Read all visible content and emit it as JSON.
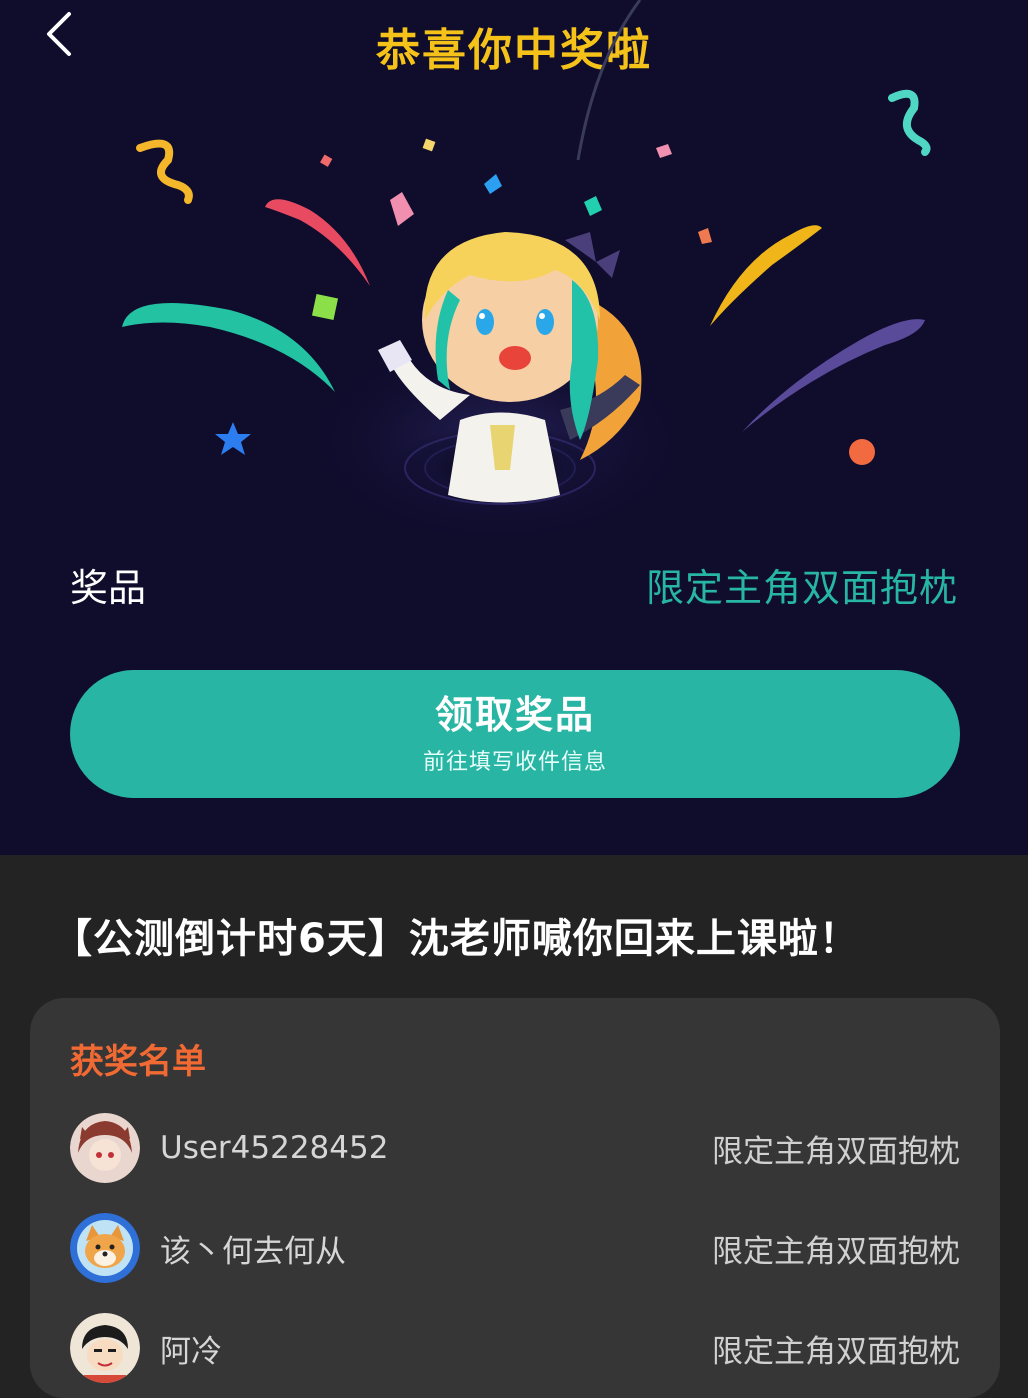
{
  "header": {
    "title": "恭喜你中奖啦"
  },
  "icons": {
    "back": "chevron-left-icon"
  },
  "prize": {
    "label": "奖品",
    "value": "限定主角双面抱枕"
  },
  "claim_button": {
    "label": "领取奖品",
    "sublabel": "前往填写收件信息"
  },
  "activity": {
    "title": "【公测倒计时6天】沈老师喊你回来上课啦！"
  },
  "winners": {
    "heading": "获奖名单",
    "items": [
      {
        "name": "User45228452",
        "prize": "限定主角双面抱枕"
      },
      {
        "name": "该丶何去何从",
        "prize": "限定主角双面抱枕"
      },
      {
        "name": "阿冷",
        "prize": "限定主角双面抱枕"
      }
    ]
  },
  "colors": {
    "hero_bg": "#0f0c2c",
    "page_bg": "#232323",
    "title": "#f5c21a",
    "accent": "#28b5a4",
    "winners_heading": "#f26a33",
    "card_bg": "#363636"
  }
}
